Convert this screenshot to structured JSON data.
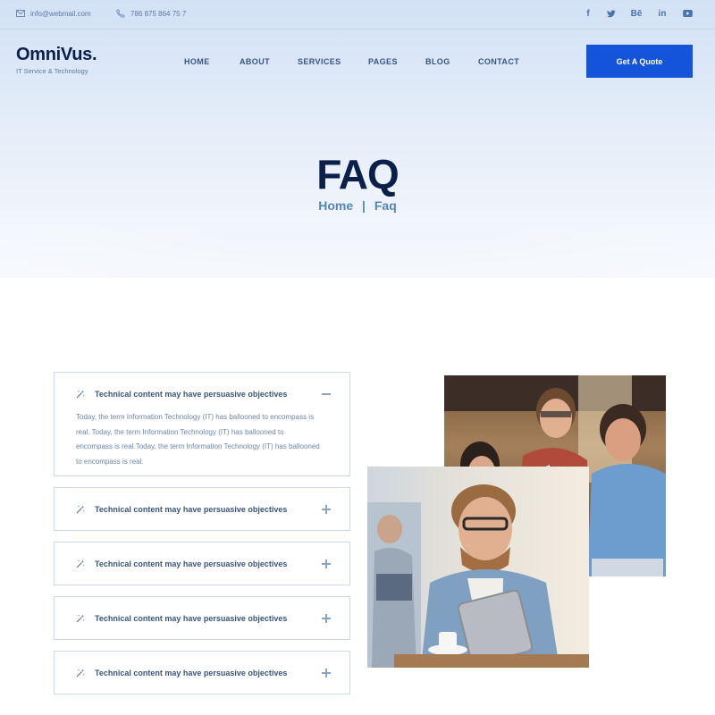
{
  "topbar": {
    "email": "info@webmail.com",
    "phone": "786 875 864 75 7",
    "socials": [
      {
        "icon": "facebook-icon",
        "glyph": "f"
      },
      {
        "icon": "twitter-icon",
        "glyph": "t"
      },
      {
        "icon": "behance-icon",
        "glyph": "Bē"
      },
      {
        "icon": "linkedin-icon",
        "glyph": "in"
      },
      {
        "icon": "youtube-icon",
        "glyph": "▶"
      }
    ]
  },
  "brand": {
    "name": "OmniVus.",
    "tagline": "IT Service & Technology"
  },
  "nav": {
    "items": [
      "HOME",
      "ABOUT",
      "SERVICES",
      "PAGES",
      "BLOG",
      "CONTACT"
    ],
    "cta": "Get A Quote"
  },
  "hero": {
    "title": "FAQ",
    "breadcrumb": [
      "Home",
      "|",
      "Faq"
    ]
  },
  "faq": [
    {
      "question": "Technical content may have persuasive objectives",
      "expanded": true,
      "answer_lines": [
        "Today, the term Information Technology (IT) has ballooned to encompass is",
        "real. Today, the term Information Technology (IT) has ballooned to",
        "encompass is real.Today, the term Information Technology (IT) has ballooned",
        "to encompass is real."
      ]
    },
    {
      "question": "Technical content may have persuasive objectives",
      "expanded": false
    },
    {
      "question": "Technical content may have persuasive objectives",
      "expanded": false
    },
    {
      "question": "Technical content may have persuasive objectives",
      "expanded": false
    },
    {
      "question": "Technical content may have persuasive objectives",
      "expanded": false
    }
  ],
  "colors": {
    "accent": "#1454da",
    "heading": "#0b1f4b",
    "muted": "#5c7aa6",
    "border": "#c9daf0"
  }
}
